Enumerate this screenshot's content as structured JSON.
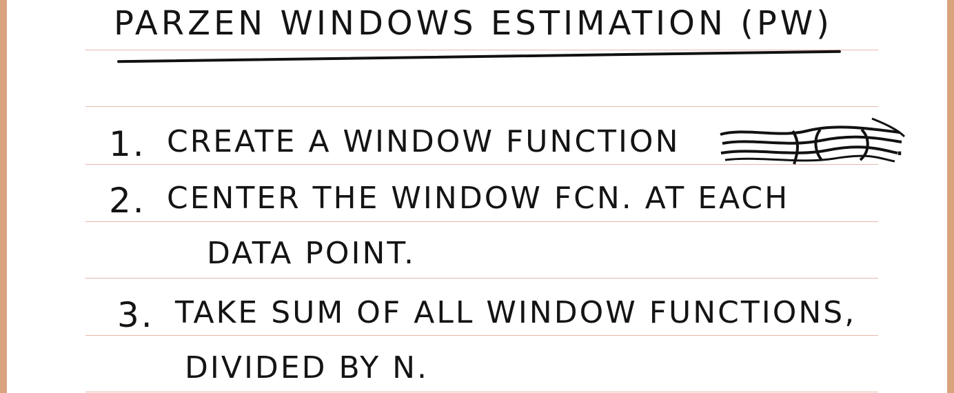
{
  "title": "Parzen Windows Estimation (PW)",
  "steps": [
    {
      "number": "1.",
      "lines": [
        "Create a window function"
      ],
      "suffix": "."
    },
    {
      "number": "2.",
      "lines": [
        "Center the window fcn. at each",
        "data point."
      ]
    },
    {
      "number": "3.",
      "lines": [
        "Take sum of all window functions,",
        "divided by n."
      ]
    }
  ],
  "colors": {
    "ink": "#141414",
    "rule": "#e8b8a8",
    "frame": "#d9a37e",
    "paper": "#ffffff"
  }
}
